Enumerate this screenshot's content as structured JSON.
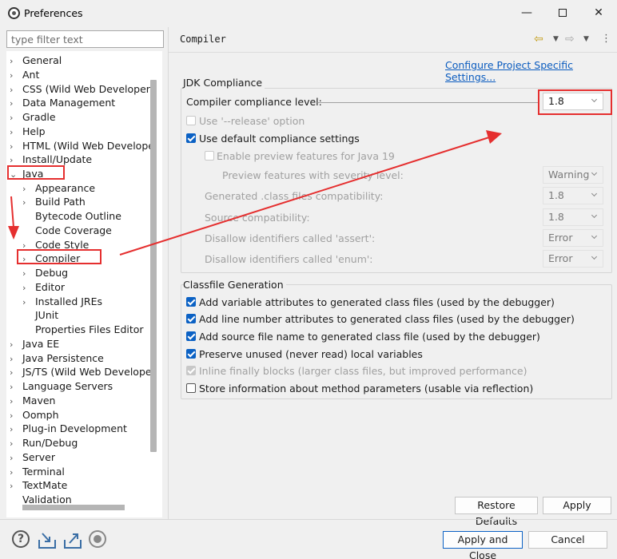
{
  "window": {
    "title": "Preferences",
    "minimize_glyph": "—",
    "close_glyph": "✕"
  },
  "sidebar": {
    "filter_placeholder": "type filter text",
    "items": [
      {
        "label": "General",
        "arrow": "›"
      },
      {
        "label": "Ant",
        "arrow": "›"
      },
      {
        "label": "CSS (Wild Web Developer)",
        "arrow": "›"
      },
      {
        "label": "Data Management",
        "arrow": "›"
      },
      {
        "label": "Gradle",
        "arrow": "›"
      },
      {
        "label": "Help",
        "arrow": "›"
      },
      {
        "label": "HTML (Wild Web Develope",
        "arrow": "›"
      },
      {
        "label": "Install/Update",
        "arrow": "›"
      },
      {
        "label": "Java",
        "arrow": "⌄"
      },
      {
        "label": "Appearance",
        "arrow": "›"
      },
      {
        "label": "Build Path",
        "arrow": "›"
      },
      {
        "label": "Bytecode Outline",
        "arrow": ""
      },
      {
        "label": "Code Coverage",
        "arrow": ""
      },
      {
        "label": "Code Style",
        "arrow": "›"
      },
      {
        "label": "Compiler",
        "arrow": "›"
      },
      {
        "label": "Debug",
        "arrow": "›"
      },
      {
        "label": "Editor",
        "arrow": "›"
      },
      {
        "label": "Installed JREs",
        "arrow": "›"
      },
      {
        "label": "JUnit",
        "arrow": ""
      },
      {
        "label": "Properties Files Editor",
        "arrow": ""
      },
      {
        "label": "Java EE",
        "arrow": "›"
      },
      {
        "label": "Java Persistence",
        "arrow": "›"
      },
      {
        "label": "JS/TS (Wild Web Developer",
        "arrow": "›"
      },
      {
        "label": "Language Servers",
        "arrow": "›"
      },
      {
        "label": "Maven",
        "arrow": "›"
      },
      {
        "label": "Oomph",
        "arrow": "›"
      },
      {
        "label": "Plug-in Development",
        "arrow": "›"
      },
      {
        "label": "Run/Debug",
        "arrow": "›"
      },
      {
        "label": "Server",
        "arrow": "›"
      },
      {
        "label": "Terminal",
        "arrow": "›"
      },
      {
        "label": "TextMate",
        "arrow": "›"
      },
      {
        "label": "Validation",
        "arrow": ""
      }
    ]
  },
  "page": {
    "title": "Compiler",
    "back_glyph": "⇦",
    "forward_glyph": "⇨",
    "dropdown_glyph": "▼",
    "menu_glyph": "⋮",
    "configure_link": "Configure Project Specific Settings...",
    "jdk": {
      "group_title": "JDK Compliance",
      "compliance_label": "Compiler compliance level:",
      "compliance_value": "1.8",
      "use_release": "Use '--release' option",
      "use_default": "Use default compliance settings",
      "enable_preview": "Enable preview features for Java 19",
      "preview_severity_label": "Preview features with severity level:",
      "preview_severity_value": "Warning",
      "generated_label": "Generated .class files compatibility:",
      "generated_value": "1.8",
      "source_label": "Source compatibility:",
      "source_value": "1.8",
      "assert_label": "Disallow identifiers called 'assert':",
      "assert_value": "Error",
      "enum_label": "Disallow identifiers called 'enum':",
      "enum_value": "Error"
    },
    "classfile": {
      "group_title": "Classfile Generation",
      "opts": [
        "Add variable attributes to generated class files (used by the debugger)",
        "Add line number attributes to generated class files (used by the debugger)",
        "Add source file name to generated class file (used by the debugger)",
        "Preserve unused (never read) local variables",
        "Inline finally blocks (larger class files, but improved performance)",
        "Store information about method parameters (usable via reflection)"
      ]
    },
    "restore_defaults": "Restore Defaults",
    "apply": "Apply"
  },
  "footer": {
    "help_glyph": "?",
    "apply_close": "Apply and Close",
    "cancel": "Cancel"
  },
  "colors": {
    "annotation": "#e52f2f",
    "link": "#0b5cbf",
    "checkbox": "#0b61c4"
  }
}
